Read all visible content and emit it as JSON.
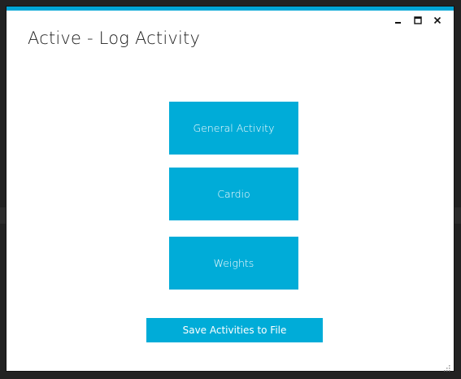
{
  "window": {
    "title": "Active - Log Activity",
    "accent_color": "#00a6d6",
    "controls": {
      "minimize_icon": "minimize-icon",
      "maximize_icon": "maximize-icon",
      "close_icon": "close-icon"
    }
  },
  "main": {
    "tiles": [
      {
        "label": "General Activity"
      },
      {
        "label": "Cardio"
      },
      {
        "label": "Weights"
      }
    ],
    "save_button_label": "Save Activities to File",
    "button_color": "#00acd8"
  },
  "footer": {
    "resize_grip_icon": "resize-grip-icon"
  }
}
